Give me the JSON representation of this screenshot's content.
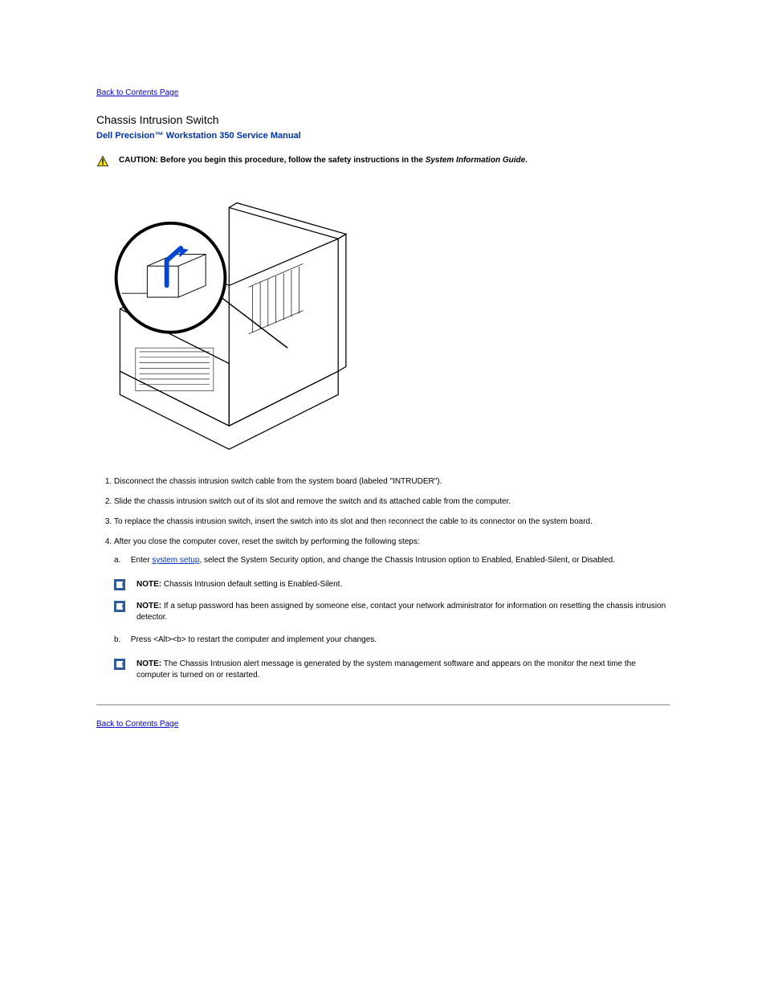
{
  "nav": {
    "back_top": "Back to Contents Page",
    "back_bottom": "Back to Contents Page"
  },
  "page": {
    "title": "Chassis Intrusion Switch",
    "manual": "Dell Precision™ Workstation 350 Service Manual"
  },
  "caution": {
    "label": "CAUTION: Before you begin this procedure, follow the safety instructions in the ",
    "guide_italic": "System Information Guide",
    "tail": "."
  },
  "steps": {
    "s1": "Disconnect the chassis intrusion switch cable from the system board (labeled \"INTRUDER\").",
    "s2": "Slide the chassis intrusion switch out of its slot and remove the switch and its attached cable from the computer.",
    "s3": "To replace the chassis intrusion switch, insert the switch into its slot and then reconnect the cable to its connector on the system board.",
    "s4": "After you close the computer cover, reset the switch by performing the following steps:",
    "s4a_label": "a.",
    "s4a_pre": "Enter ",
    "s4a_link": "system setup",
    "s4a_post": ", select the System Security option, and change the Chassis Intrusion option to Enabled, Enabled-Silent, or Disabled.",
    "s4b_label": "b.",
    "s4b": "Press <Alt><b> to restart the computer and implement your changes."
  },
  "notes": {
    "n1_label": "NOTE:",
    "n1_text": " Chassis Intrusion default setting is Enabled-Silent.",
    "n2_label": "NOTE:",
    "n2_text": " If a setup password has been assigned by someone else, contact your network administrator for information on resetting the chassis intrusion detector.",
    "n3_label": "NOTE:",
    "n3_text": " The Chassis Intrusion alert message is generated by the system management software and appears on the monitor the next time the computer is turned on or restarted."
  }
}
